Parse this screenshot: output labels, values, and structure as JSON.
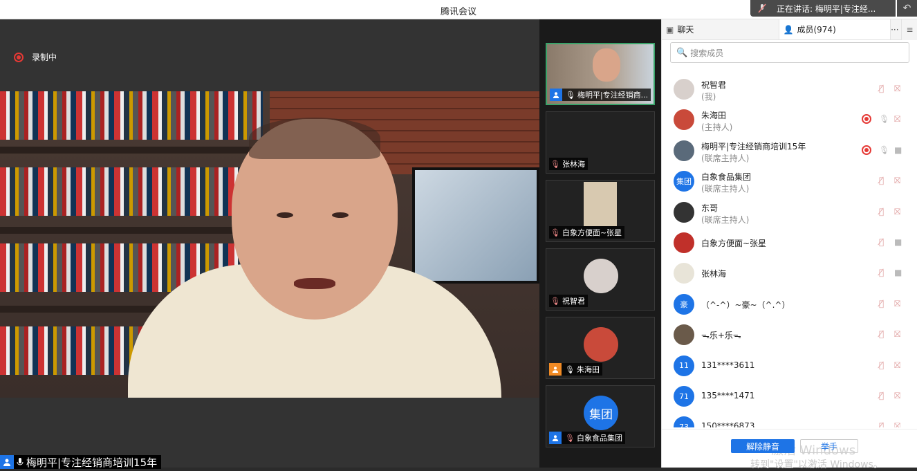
{
  "window": {
    "title": "腾讯会议"
  },
  "speaking_banner": {
    "text": "正在讲话: 梅明平|专注经..."
  },
  "recording": {
    "text": "录制中"
  },
  "main_video": {
    "name": "梅明平|专注经销商培训15年"
  },
  "thumbnails": [
    {
      "name": "梅明平|专注经销商...",
      "active": true
    },
    {
      "name": "张林海"
    },
    {
      "name": "白象方便面~张星"
    },
    {
      "name": "祝智君"
    },
    {
      "name": "朱海田"
    },
    {
      "name": "白象食品集团",
      "avatar_text": "集团"
    }
  ],
  "panel": {
    "chat_tab": "聊天",
    "members_tab": "成员(974)",
    "more": "···",
    "close": "×",
    "menu": "≡",
    "search_placeholder": "搜索成员"
  },
  "members": [
    {
      "name": "祝智君",
      "role": "(我)",
      "avatar_color": "#d8d0cc",
      "mic": "muted",
      "cam": "muted"
    },
    {
      "name": "朱海田",
      "role": "(主持人)",
      "avatar_color": "#c94a3a",
      "recording": true,
      "mic": "on",
      "cam": "muted"
    },
    {
      "name": "梅明平|专注经销商培训15年",
      "role": "(联席主持人)",
      "avatar_color": "#5a6a7a",
      "recording": true,
      "mic": "on",
      "cam": "on"
    },
    {
      "name": "白象食品集团",
      "role": "(联席主持人)",
      "avatar_text": "集团",
      "avatar_color": "#1e74e6",
      "mic": "muted",
      "cam": "muted"
    },
    {
      "name": "东哥",
      "role": "(联席主持人)",
      "avatar_color": "#333333",
      "mic": "muted",
      "cam": "muted"
    },
    {
      "name": "白象方便面~张星",
      "role": "",
      "avatar_color": "#c0302a",
      "mic": "muted",
      "cam": "on"
    },
    {
      "name": "张林海",
      "role": "",
      "avatar_color": "#e8e4d8",
      "mic": "muted",
      "cam": "on"
    },
    {
      "name": "（^-^）~豪~（^.^）",
      "role": "",
      "avatar_text": "豪",
      "avatar_color": "#1e74e6",
      "mic": "muted",
      "cam": "muted"
    },
    {
      "name": "ᯓ乐+乐ᯓ",
      "role": "",
      "avatar_color": "#6a5a4a",
      "mic": "muted",
      "cam": "muted"
    },
    {
      "name": "131****3611",
      "role": "",
      "avatar_text": "11",
      "avatar_color": "#1e74e6",
      "mic": "muted",
      "cam": "muted"
    },
    {
      "name": "135****1471",
      "role": "",
      "avatar_text": "71",
      "avatar_color": "#1e74e6",
      "mic": "muted",
      "cam": "muted"
    },
    {
      "name": "150****6873",
      "role": "",
      "avatar_text": "73",
      "avatar_color": "#1e74e6",
      "mic": "muted",
      "cam": "muted"
    }
  ],
  "bottom": {
    "unmute": "解除静音",
    "raise_hand": "举手",
    "watermark_1": "激活 Windows",
    "watermark_2": "转到\"设置\"以激活 Windows。"
  }
}
